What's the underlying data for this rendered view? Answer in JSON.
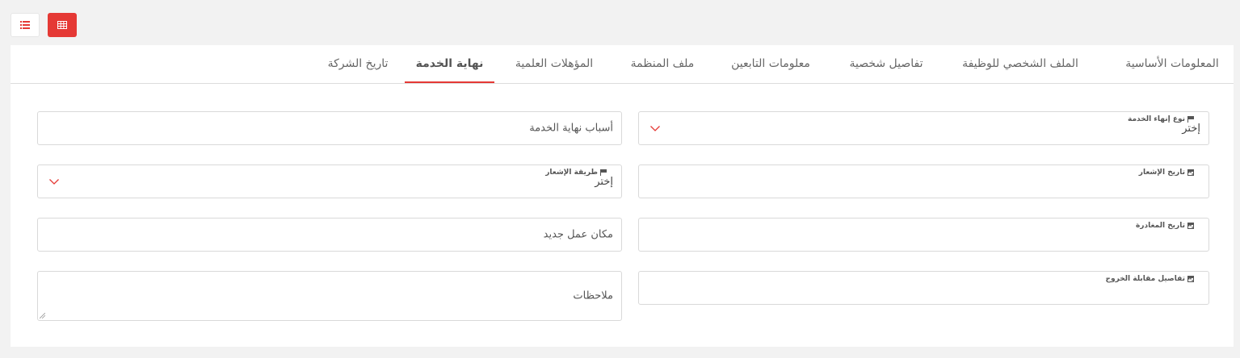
{
  "toolbar": {
    "list_view_icon": "list-icon",
    "grid_view_icon": "grid-icon",
    "accent": "#e53935"
  },
  "tabs": [
    {
      "label": "المعلومات الأساسية",
      "active": false
    },
    {
      "label": "الملف الشخصي للوظيفة",
      "active": false
    },
    {
      "label": "تفاصيل شخصية",
      "active": false
    },
    {
      "label": "معلومات التابعين",
      "active": false
    },
    {
      "label": "ملف المنظمة",
      "active": false
    },
    {
      "label": "المؤهلات العلمية",
      "active": false
    },
    {
      "label": "نهاية الخدمة",
      "active": true
    },
    {
      "label": "تاريخ الشركة",
      "active": false
    }
  ],
  "form": {
    "termination_type": {
      "label": "نوع إنهاء الخدمة",
      "value": "إختر",
      "icon": "flag-icon"
    },
    "end_reasons": {
      "placeholder": "أسباب نهاية الخدمة"
    },
    "notice_date": {
      "label": "تاريخ الإشعار",
      "value": "",
      "icon": "calendar-icon"
    },
    "notice_method": {
      "label": "طريقة الإشعار",
      "value": "إختر",
      "icon": "flag-icon"
    },
    "departure_date": {
      "label": "تاريخ المغادرة",
      "value": "",
      "icon": "calendar-icon"
    },
    "new_workplace": {
      "placeholder": "مكان عمل جديد"
    },
    "exit_interview": {
      "label": "تفاصيل مقابلة الخروج",
      "value": "",
      "icon": "calendar-icon"
    },
    "notes": {
      "placeholder": "ملاحظات"
    }
  }
}
